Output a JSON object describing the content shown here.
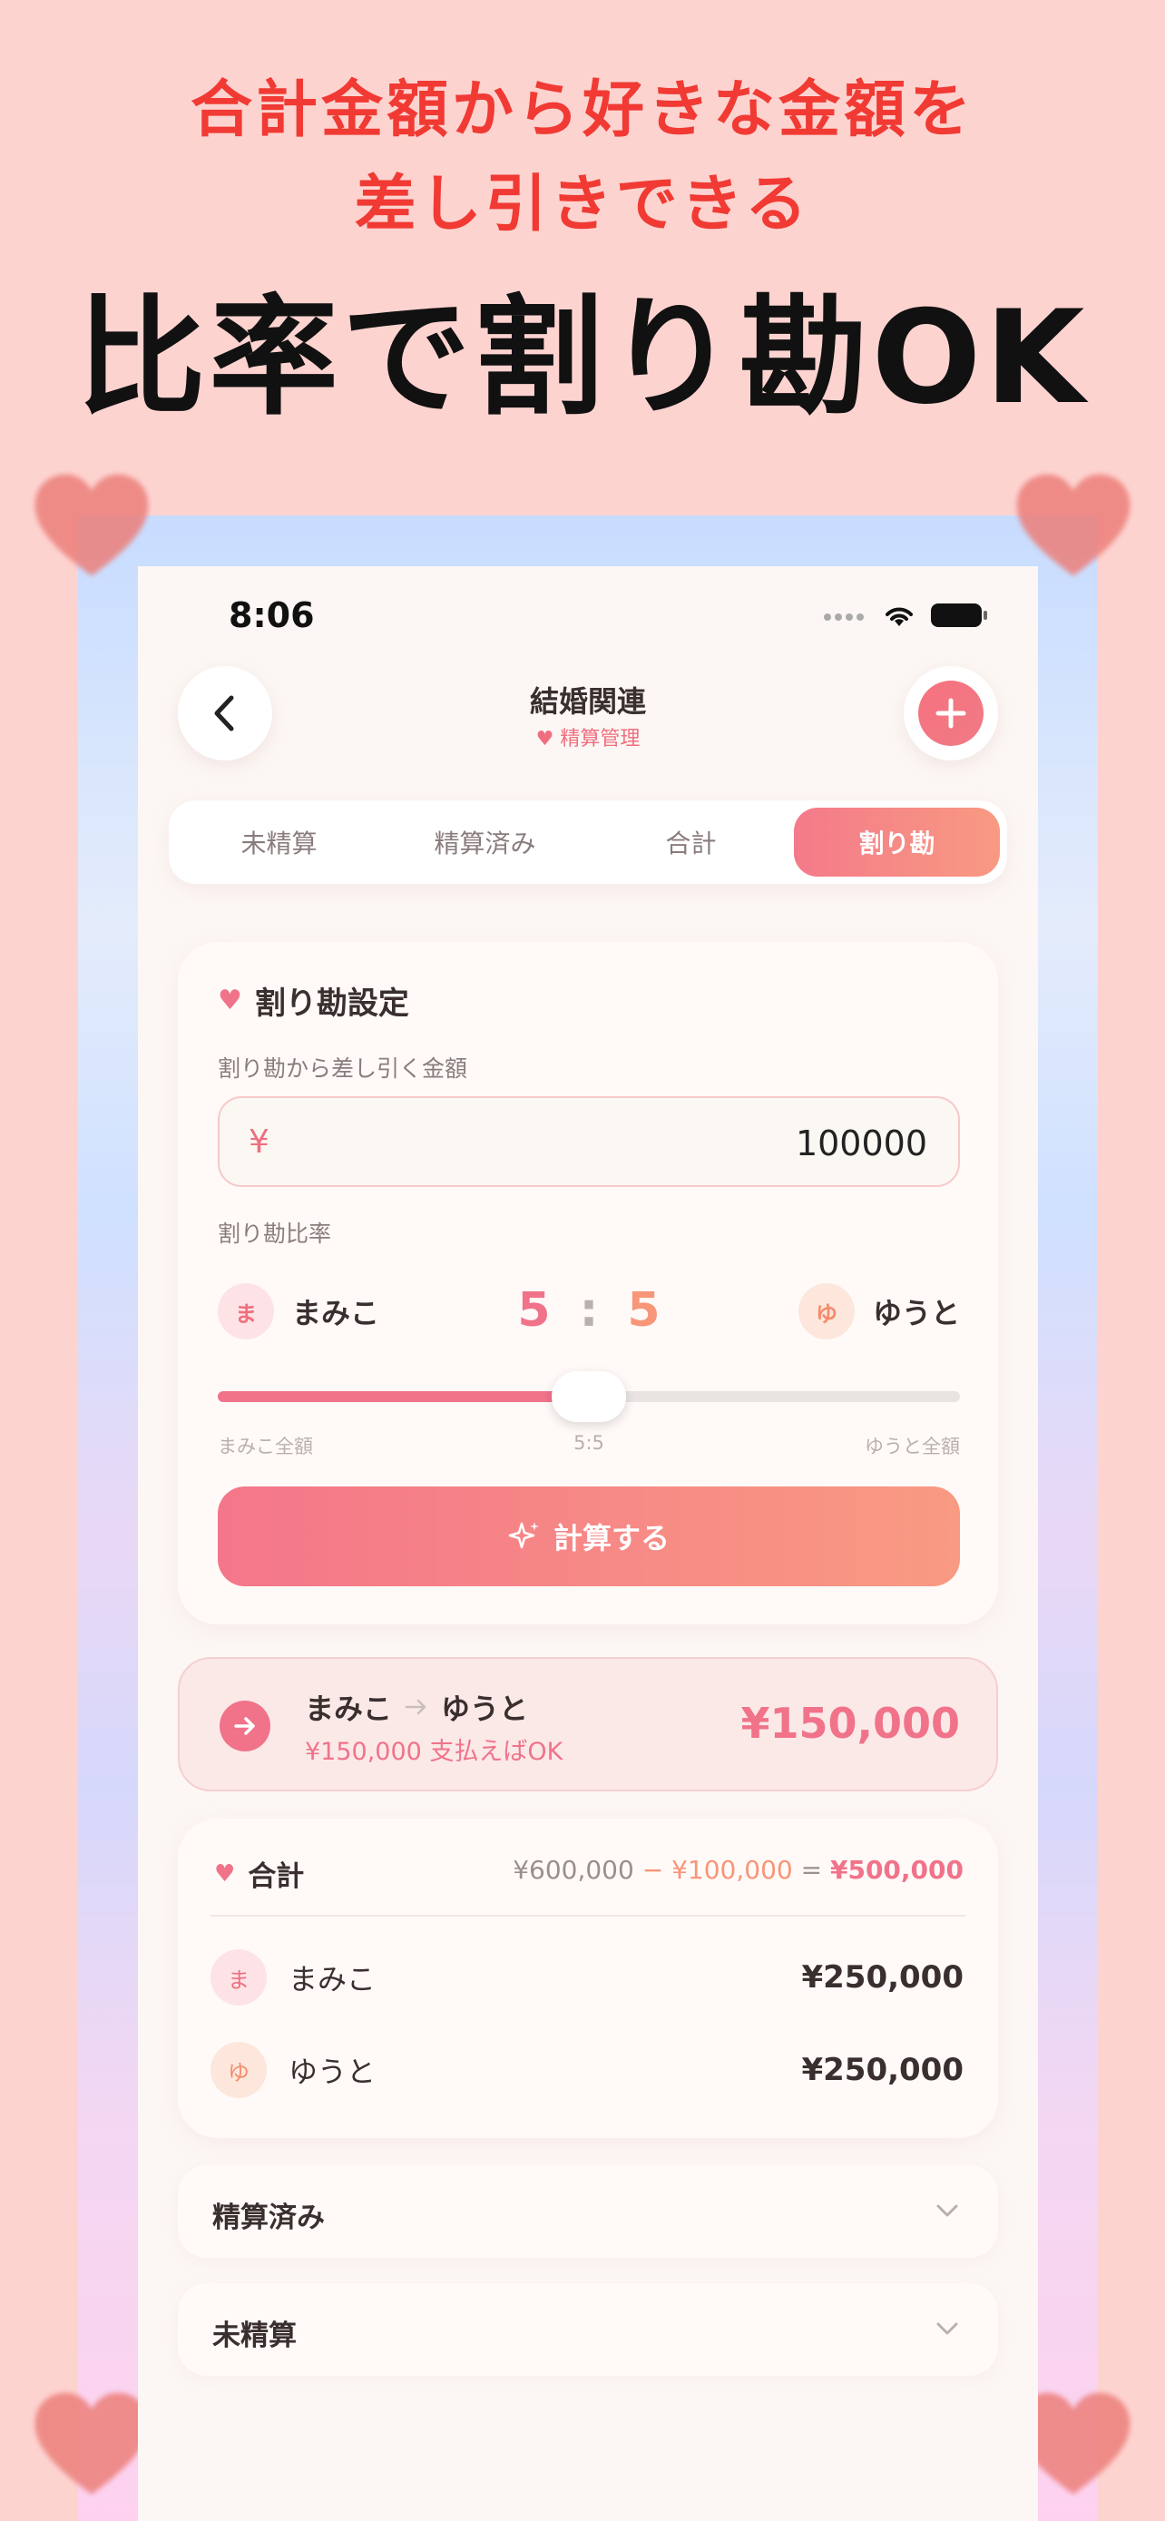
{
  "promo": {
    "line1": "合計金額から好きな金額を",
    "line2": "差し引きできる",
    "headline": "比率で割り勘OK"
  },
  "status_bar": {
    "time": "8:06"
  },
  "nav": {
    "title": "結婚関連",
    "subtitle": "精算管理",
    "back_icon": "chevron-left-icon",
    "add_icon": "plus-icon"
  },
  "tabs": [
    {
      "label": "未精算",
      "active": false
    },
    {
      "label": "精算済み",
      "active": false
    },
    {
      "label": "合計",
      "active": false
    },
    {
      "label": "割り勘",
      "active": true
    }
  ],
  "split_settings": {
    "title": "割り勘設定",
    "deduct_label": "割り勘から差し引く金額",
    "currency_symbol": "¥",
    "deduct_value": "100000",
    "ratio_label": "割り勘比率",
    "person_a": {
      "initial": "ま",
      "name": "まみこ"
    },
    "person_b": {
      "initial": "ゆ",
      "name": "ゆうと"
    },
    "ratio_a": "5",
    "ratio_sep": ":",
    "ratio_b": "5",
    "slider_fraction": 0.5,
    "slider_left_label": "まみこ全額",
    "slider_center_label": "5:5",
    "slider_right_label": "ゆうと全額",
    "calc_button": "計算する"
  },
  "result": {
    "from": "まみこ",
    "to": "ゆうと",
    "sub": "¥150,000 支払えばOK",
    "amount": "¥150,000"
  },
  "summary": {
    "title": "合計",
    "total": "¥600,000",
    "minus_sign": "−",
    "deduction": "¥100,000",
    "equals": "=",
    "net": "¥500,000",
    "rows": [
      {
        "initial": "ま",
        "name": "まみこ",
        "amount": "¥250,000"
      },
      {
        "initial": "ゆ",
        "name": "ゆうと",
        "amount": "¥250,000"
      }
    ]
  },
  "sections": {
    "settled": "精算済み",
    "unsettled": "未精算"
  },
  "colors": {
    "background": "#fdd3d0",
    "accent_red": "#f03a33",
    "accent_pink": "#f0738a",
    "accent_peach": "#f79678"
  }
}
